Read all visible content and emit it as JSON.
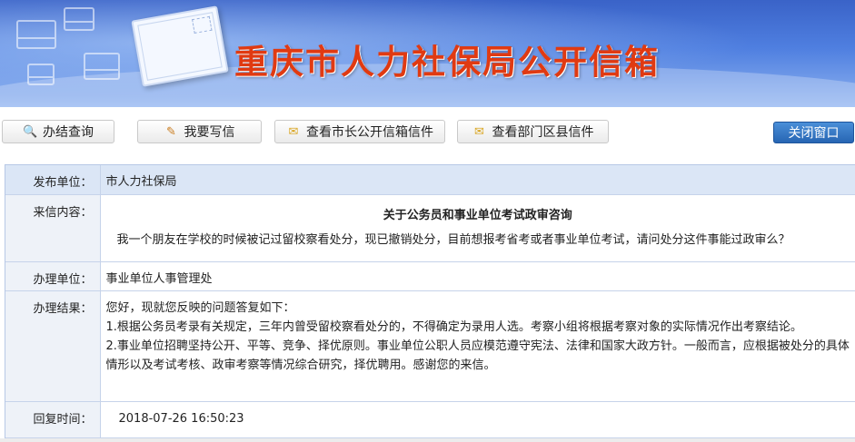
{
  "banner": {
    "title": "重庆市人力社保局公开信箱"
  },
  "toolbar": {
    "buttons": [
      {
        "label": "办结查询",
        "icon": "search-icon"
      },
      {
        "label": "我要写信",
        "icon": "write-icon"
      },
      {
        "label": "查看市长公开信箱信件",
        "icon": "mail-icon"
      },
      {
        "label": "查看部门区县信件",
        "icon": "mail-icon"
      }
    ],
    "close_label": "关闭窗口"
  },
  "letter": {
    "publisher_label": "发布单位：",
    "publisher": "市人力社保局",
    "content_label": "来信内容：",
    "subject": "关于公务员和事业单位考试政审咨询",
    "question": "我一个朋友在学校的时候被记过留校察看处分，现已撤销处分，目前想报考省考或者事业单位考试，请问处分这件事能过政审么？",
    "handler_label": "办理单位：",
    "handler": "事业单位人事管理处",
    "result_label": "办理结果：",
    "result_lines": [
      "您好，现就您反映的问题答复如下：",
      "1.根据公务员考录有关规定，三年内曾受留校察看处分的，不得确定为录用人选。考察小组将根据考察对象的实际情况作出考察结论。",
      "2.事业单位招聘坚持公开、平等、竞争、择优原则。事业单位公职人员应模范遵守宪法、法律和国家大政方针。一般而言，应根据被处分的具体情形以及考试考核、政审考察等情况综合研究，择优聘用。感谢您的来信。"
    ],
    "reply_time_label": "回复时间：",
    "reply_time": "2018-07-26 16:50:23"
  }
}
